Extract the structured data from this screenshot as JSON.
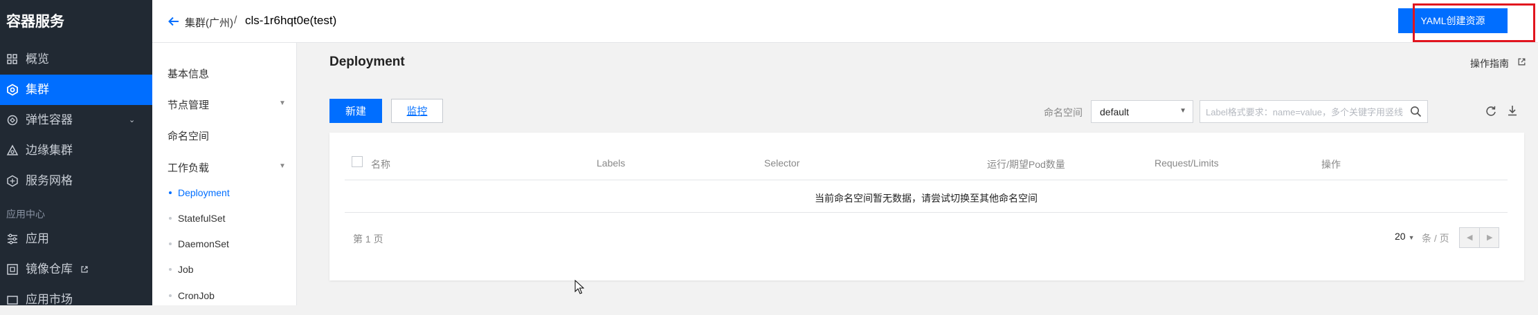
{
  "sidebar": {
    "brand": "容器服务",
    "items": [
      {
        "label": "概览",
        "icon": "grid-icon"
      },
      {
        "label": "集群",
        "icon": "cluster-icon",
        "active": true
      },
      {
        "label": "弹性容器",
        "icon": "elastic-container-icon",
        "expandable": true
      },
      {
        "label": "边缘集群",
        "icon": "edge-cluster-icon"
      },
      {
        "label": "服务网格",
        "icon": "service-mesh-icon"
      }
    ],
    "section_label": "应用中心",
    "section_items": [
      {
        "label": "应用",
        "icon": "app-icon"
      },
      {
        "label": "镜像仓库",
        "icon": "image-registry-icon",
        "external": true
      },
      {
        "label": "应用市场",
        "icon": "market-icon"
      }
    ]
  },
  "header": {
    "breadcrumb_parent": "集群(广州)",
    "breadcrumb_separator": "/",
    "breadcrumb_current": "cls-1r6hqt0e(test)",
    "yaml_button": "YAML创建资源"
  },
  "subnav": {
    "items": [
      "基本信息",
      "节点管理",
      "命名空间",
      "工作负载"
    ],
    "workload_children": [
      "Deployment",
      "StatefulSet",
      "DaemonSet",
      "Job",
      "CronJob"
    ],
    "active_child": "Deployment"
  },
  "main": {
    "title": "Deployment",
    "guide_link": "操作指南",
    "new_button": "新建",
    "monitor_button": "监控",
    "namespace_label": "命名空间",
    "namespace_value": "default",
    "search_placeholder": "Label格式要求：name=value，多个关键字用竖线",
    "columns": [
      "名称",
      "Labels",
      "Selector",
      "运行/期望Pod数量",
      "Request/Limits",
      "操作"
    ],
    "empty_message": "当前命名空间暂无数据，请尝试切换至其他命名空间",
    "pager": {
      "page_text": "第 1 页",
      "page_size": "20",
      "per_page_label": "条 / 页"
    }
  },
  "colors": {
    "primary": "#006eff",
    "sidebar_bg": "#212933",
    "highlight": "#e1141e"
  }
}
